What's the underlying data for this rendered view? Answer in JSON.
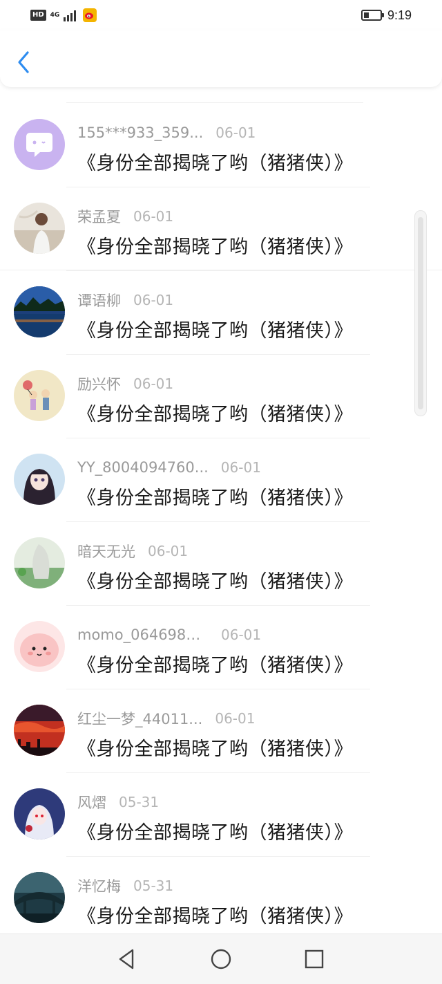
{
  "status_bar": {
    "hd_label": "HD",
    "network_label": "4G",
    "time": "9:19"
  },
  "header": {
    "back_icon": "chevron-left-icon",
    "accent_color": "#2d8cf0"
  },
  "items": [
    {
      "username": "155***933_359...",
      "date": "06-01",
      "title": "《身份全部揭晓了哟（猪猪侠）》",
      "avatar": "default-chat-avatar"
    },
    {
      "username": "荣孟夏",
      "date": "06-01",
      "title": "《身份全部揭晓了哟（猪猪侠）》",
      "avatar": "photo-avatar"
    },
    {
      "username": "谭语柳",
      "date": "06-01",
      "title": "《身份全部揭晓了哟（猪猪侠）》",
      "avatar": "lake-avatar"
    },
    {
      "username": "励兴怀",
      "date": "06-01",
      "title": "《身份全部揭晓了哟（猪猪侠）》",
      "avatar": "cartoon-couple-avatar"
    },
    {
      "username": "YY_8004094760...",
      "date": "06-01",
      "title": "《身份全部揭晓了哟（猪猪侠）》",
      "avatar": "anime-girl-avatar"
    },
    {
      "username": "暗天无光",
      "date": "06-01",
      "title": "《身份全部揭晓了哟（猪猪侠）》",
      "avatar": "green-scene-avatar"
    },
    {
      "username": "momo_0646988...",
      "date": "06-01",
      "title": "《身份全部揭晓了哟（猪猪侠）》",
      "avatar": "pink-blob-avatar"
    },
    {
      "username": "红尘一梦_44011...",
      "date": "06-01",
      "title": "《身份全部揭晓了哟（猪猪侠）》",
      "avatar": "red-sky-avatar"
    },
    {
      "username": "风熠",
      "date": "05-31",
      "title": "《身份全部揭晓了哟（猪猪侠）》",
      "avatar": "anime-character-avatar"
    },
    {
      "username": "洋忆梅",
      "date": "05-31",
      "title": "《身份全部揭晓了哟（猪猪侠）》",
      "avatar": "bridge-avatar"
    }
  ],
  "nav_bar": {
    "back": "triangle-back-icon",
    "home": "circle-home-icon",
    "recents": "square-recents-icon"
  }
}
